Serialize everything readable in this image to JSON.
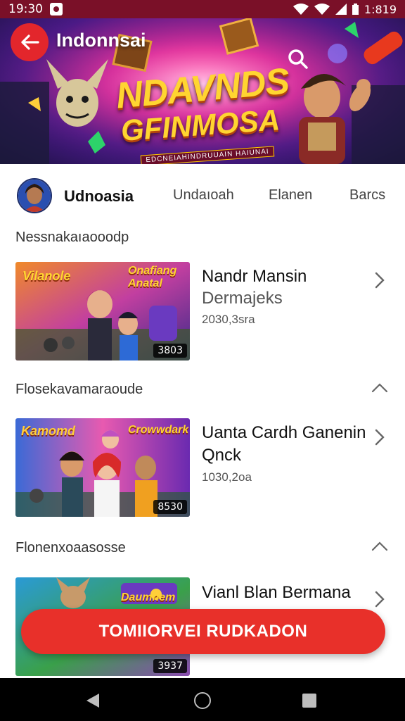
{
  "status_bar": {
    "time": "19:30",
    "battery_text": "1:819"
  },
  "header": {
    "title": "Indonnsai",
    "banner_line1": "NDAVNDS",
    "banner_line2": "GFINMOSA",
    "banner_tag": "EDCNEIAHINDRUUAIN HAIUNAI"
  },
  "channel": {
    "name": "Udnoasia",
    "tabs": [
      "Undaıoah",
      "Elanen",
      "Barcs"
    ]
  },
  "sections": [
    {
      "title": "Nessnakaıaooodp",
      "card": {
        "thumb_label_left": "Vilanole",
        "thumb_label_right": "Onafiang Anatal",
        "duration": "3803",
        "title": "Nandr Mansin",
        "subtitle": "Dermajeks",
        "meta": "2030,3sra"
      }
    },
    {
      "title": "Flosekavamaraoude",
      "card": {
        "thumb_label_left": "Kamomd",
        "thumb_label_right": "Crowwdark",
        "duration": "8530",
        "title": "Uanta Cardh Ganenin",
        "subtitle": "Qnck",
        "meta": "1030,2oa"
      }
    },
    {
      "title": "Flonenxoaasosse",
      "card": {
        "thumb_label_right": "Daumnem",
        "duration": "3937",
        "title": "Vianl Blan Bermana"
      }
    }
  ],
  "cta": {
    "label": "TOMIIORVEI RUDKADON"
  },
  "colors": {
    "accent": "#e8302a",
    "status_bar": "#7a1028"
  }
}
